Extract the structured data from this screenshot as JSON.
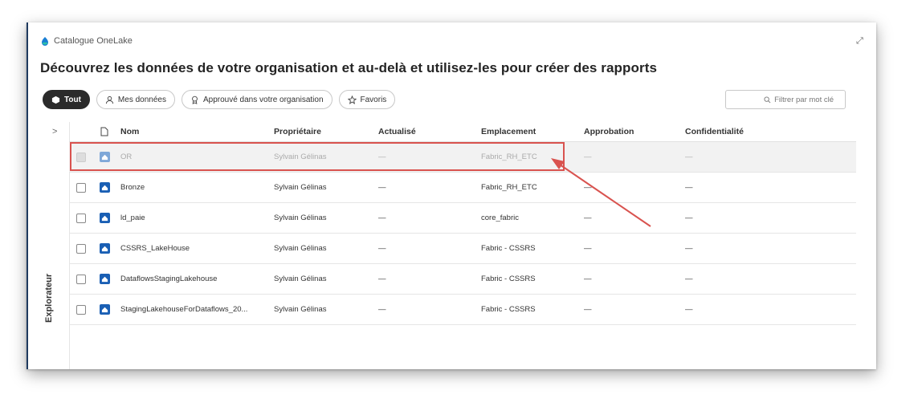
{
  "breadcrumb": {
    "label": "Catalogue OneLake"
  },
  "page_title": "Découvrez les données de votre organisation et au-delà et utilisez-les pour créer des rapports",
  "filters": [
    {
      "label": "Tout",
      "active": true,
      "icon": "cube-icon"
    },
    {
      "label": "Mes données",
      "active": false,
      "icon": "person-icon"
    },
    {
      "label": "Approuvé dans votre organisation",
      "active": false,
      "icon": "ribbon-icon"
    },
    {
      "label": "Favoris",
      "active": false,
      "icon": "star-icon"
    }
  ],
  "search": {
    "placeholder": "Filtrer par mot clé"
  },
  "explorer": {
    "label": "Explorateur",
    "toggle": ">"
  },
  "table": {
    "headers": {
      "name": "Nom",
      "owner": "Propriétaire",
      "updated": "Actualisé",
      "location": "Emplacement",
      "approval": "Approbation",
      "confidentiality": "Confidentialité"
    },
    "rows": [
      {
        "name": "OR",
        "owner": "Sylvain Gélinas",
        "updated": "—",
        "location": "Fabric_RH_ETC",
        "approval": "—",
        "confidentiality": "—"
      },
      {
        "name": "Bronze",
        "owner": "Sylvain Gélinas",
        "updated": "—",
        "location": "Fabric_RH_ETC",
        "approval": "—",
        "confidentiality": "—"
      },
      {
        "name": "ld_paie",
        "owner": "Sylvain Gélinas",
        "updated": "—",
        "location": "core_fabric",
        "approval": "—",
        "confidentiality": "—"
      },
      {
        "name": "CSSRS_LakeHouse",
        "owner": "Sylvain Gélinas",
        "updated": "—",
        "location": "Fabric - CSSRS",
        "approval": "—",
        "confidentiality": "—"
      },
      {
        "name": "DataflowsStagingLakehouse",
        "owner": "Sylvain Gélinas",
        "updated": "—",
        "location": "Fabric - CSSRS",
        "approval": "—",
        "confidentiality": "—"
      },
      {
        "name": "StagingLakehouseForDataflows_20...",
        "owner": "Sylvain Gélinas",
        "updated": "—",
        "location": "Fabric - CSSRS",
        "approval": "—",
        "confidentiality": "—"
      }
    ]
  },
  "colors": {
    "highlight_border": "#d9534f",
    "lakehouse_icon": "#1a5fb4",
    "active_pill": "#2b2b2b"
  }
}
